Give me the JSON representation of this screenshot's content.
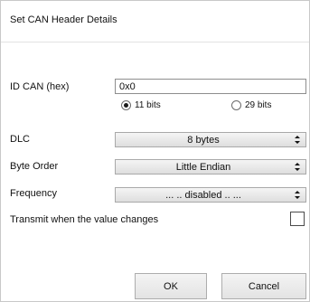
{
  "dialog": {
    "title": "Set CAN Header Details",
    "id_can": {
      "label": "ID CAN (hex)",
      "value": "0x0"
    },
    "bits": {
      "option_11": "11 bits",
      "option_29": "29 bits",
      "selected": "11 bits"
    },
    "dlc": {
      "label": "DLC",
      "value": "8 bytes"
    },
    "byte_order": {
      "label": "Byte Order",
      "value": "Little Endian"
    },
    "frequency": {
      "label": "Frequency",
      "value": "... .. disabled .. ..."
    },
    "transmit": {
      "label": "Transmit when the value changes",
      "checked": false
    },
    "buttons": {
      "ok": "OK",
      "cancel": "Cancel"
    }
  }
}
